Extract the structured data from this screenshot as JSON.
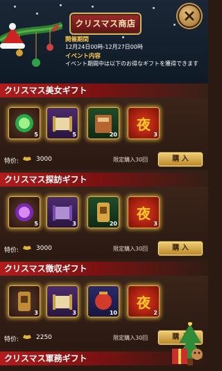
{
  "header": {
    "title": "クリスマス商店",
    "event_period_label": "開催期間",
    "event_period_value": "12月24日00時-12月27日00時",
    "event_content_label": "イベント内容",
    "event_content_text": "イベント期間中は以下のお得なギフトを獲得できます"
  },
  "sections": [
    {
      "title": "クリスマス美女ギフト",
      "items": [
        {
          "icon": "green-gem-icon",
          "count": "5"
        },
        {
          "icon": "golden-scroll-icon",
          "count": "5"
        },
        {
          "icon": "brown-book-icon",
          "count": "20"
        },
        {
          "icon": "night-kanji-icon",
          "char": "夜",
          "count": "3"
        }
      ],
      "price_label": "特价:",
      "price": "3000",
      "limit": "限定購入30回",
      "buy_label": "購 入"
    },
    {
      "title": "クリスマス探訪ギフト",
      "items": [
        {
          "icon": "purple-gem-icon",
          "count": "5"
        },
        {
          "icon": "purple-scroll-icon",
          "count": "3"
        },
        {
          "icon": "travel-token-icon",
          "count": "20"
        },
        {
          "icon": "night-kanji-icon",
          "char": "夜",
          "count": "3"
        }
      ],
      "price_label": "特价:",
      "price": "3000",
      "limit": "限定購入30回",
      "buy_label": "購 入"
    },
    {
      "title": "クリスマス徴収ギフト",
      "items": [
        {
          "icon": "tax-token-icon",
          "count": "3"
        },
        {
          "icon": "tax-scroll-icon",
          "count": "3"
        },
        {
          "icon": "red-lantern-icon",
          "count": "10"
        },
        {
          "icon": "night-kanji-icon",
          "char": "夜",
          "count": "2"
        }
      ],
      "price_label": "特价:",
      "price": "2250",
      "limit": "限定購入30回",
      "buy_label": "購 入"
    },
    {
      "title": "クリスマス軍務ギフト"
    }
  ],
  "colors": {
    "accent_gold": "#e0b14a",
    "title_red": "#b21c1c",
    "event_yellow": "#ffcc4d"
  }
}
